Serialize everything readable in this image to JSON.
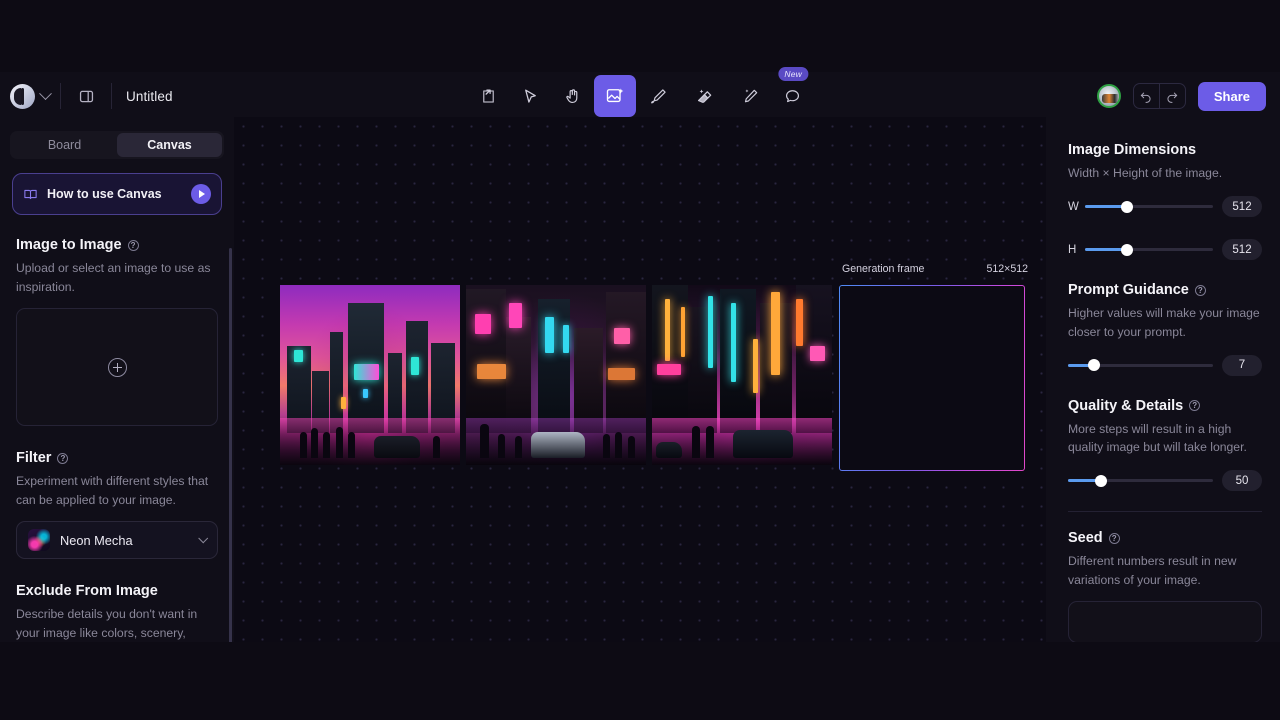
{
  "app": {
    "title": "Untitled",
    "accent": "#6c5ce7",
    "background": "#0d0b14",
    "panel_background": "#100e18"
  },
  "topbar": {
    "logo_name": "app-logo",
    "workspace_chevron": "chevron-down-icon",
    "panel_toggle_icon": "panel-toggle-icon",
    "document_title": "Untitled",
    "tools": [
      {
        "name": "share-export-tool",
        "icon": "share-arrow-icon",
        "active": false,
        "has_chevron": false,
        "badge": ""
      },
      {
        "name": "select-tool",
        "icon": "cursor-arrow-icon",
        "active": false,
        "has_chevron": false,
        "badge": ""
      },
      {
        "name": "hand-tool",
        "icon": "hand-icon",
        "active": false,
        "has_chevron": false,
        "badge": ""
      },
      {
        "name": "generate-image-tool",
        "icon": "image-sparkle-icon",
        "active": true,
        "has_chevron": false,
        "badge": ""
      },
      {
        "name": "draw-tool",
        "icon": "pencil-icon",
        "active": false,
        "has_chevron": true,
        "badge": ""
      },
      {
        "name": "erase-tool",
        "icon": "magic-eraser-icon",
        "active": false,
        "has_chevron": true,
        "badge": ""
      },
      {
        "name": "magic-edit-tool",
        "icon": "magic-wand-icon",
        "active": false,
        "has_chevron": false,
        "badge": ""
      },
      {
        "name": "comment-tool",
        "icon": "speech-bubble-icon",
        "active": false,
        "has_chevron": false,
        "badge": "New"
      }
    ],
    "avatar_label": "user-avatar",
    "undo_label": "undo-icon",
    "redo_label": "redo-icon",
    "share_label": "Share"
  },
  "sidebar": {
    "tabs": [
      {
        "label": "Board",
        "active": false
      },
      {
        "label": "Canvas",
        "active": true
      }
    ],
    "howto": {
      "label": "How to use Canvas",
      "book_icon": "book-icon",
      "play_icon": "play-icon"
    },
    "image_to_image": {
      "title": "Image to Image",
      "description": "Upload or select an image to use as inspiration.",
      "upload_icon": "plus-circle-icon"
    },
    "filter": {
      "title": "Filter",
      "description": "Experiment with different styles that can be applied to your image.",
      "selected": "Neon Mecha",
      "chevron": "chevron-down-icon"
    },
    "exclude": {
      "title": "Exclude From Image",
      "description": "Describe details you don't want in your image like colors, scenery,"
    }
  },
  "canvas": {
    "generation_frame": {
      "label": "Generation frame",
      "size": "512×512"
    },
    "images": [
      {
        "name": "generated-image-1",
        "alt": "Cyberpunk city with magenta sky and neon towers"
      },
      {
        "name": "generated-image-2",
        "alt": "Neon street at night with a car on wet road"
      },
      {
        "name": "generated-image-3",
        "alt": "Neon canyon street with two figures and a vehicle"
      }
    ]
  },
  "rightpanel": {
    "dimensions": {
      "title": "Image Dimensions",
      "description": "Width × Height of the image.",
      "width": {
        "label": "W",
        "value": "512",
        "percent": 33
      },
      "height": {
        "label": "H",
        "value": "512",
        "percent": 33
      }
    },
    "prompt_guidance": {
      "title": "Prompt Guidance",
      "description": "Higher values will make your image closer to your prompt.",
      "value": "7",
      "percent": 18
    },
    "quality": {
      "title": "Quality & Details",
      "description": "More steps will result in a high quality image but will take longer.",
      "value": "50",
      "percent": 23
    },
    "seed": {
      "title": "Seed",
      "description": "Different numbers result in new variations of your image.",
      "value": "",
      "placeholder": ""
    }
  }
}
